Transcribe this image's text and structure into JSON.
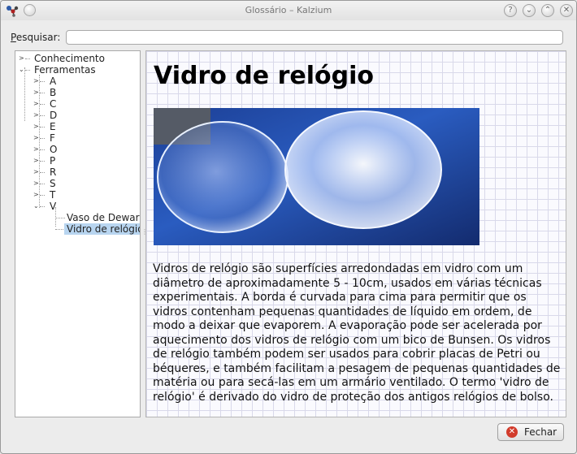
{
  "window": {
    "title": "Glossário – Kalzium",
    "controls": [
      "help",
      "minimize",
      "maximize",
      "close"
    ]
  },
  "search": {
    "label": "Pesquisar:",
    "value": "",
    "placeholder": ""
  },
  "tree": {
    "items": [
      {
        "label": "Conhecimento",
        "expanded": false,
        "level": 0
      },
      {
        "label": "Ferramentas",
        "expanded": true,
        "level": 0
      },
      {
        "label": "A",
        "level": 1
      },
      {
        "label": "B",
        "level": 1
      },
      {
        "label": "C",
        "level": 1
      },
      {
        "label": "D",
        "level": 1
      },
      {
        "label": "E",
        "level": 1
      },
      {
        "label": "F",
        "level": 1
      },
      {
        "label": "O",
        "level": 1
      },
      {
        "label": "P",
        "level": 1
      },
      {
        "label": "R",
        "level": 1
      },
      {
        "label": "S",
        "level": 1
      },
      {
        "label": "T",
        "level": 1
      },
      {
        "label": "V",
        "level": 1,
        "expanded": true
      },
      {
        "label": "Vaso de Dewar",
        "level": 2
      },
      {
        "label": "Vidro de relógio",
        "level": 2,
        "selected": true
      }
    ]
  },
  "article": {
    "title": "Vidro de relógio",
    "body": "Vidros de relógio são superfícies arredondadas em vidro com um diâmetro de aproximadamente 5 - 10cm, usados em várias técnicas experimentais. A borda é curvada para cima para permitir que os vidros contenham pequenas quantidades de líquido em ordem, de modo a deixar que evaporem. A evaporação pode ser acelerada por aquecimento dos vidros de relógio com um bico de Bunsen. Os vidros de relógio também podem ser usados para cobrir placas de Petri ou béqueres, e também facilitam a pesagem de pequenas quantidades de matéria ou para secá-las em um armário ventilado. O termo 'vidro de relógio' é derivado do vidro de proteção dos antigos relógios de bolso."
  },
  "footer": {
    "close_label": "Fechar"
  },
  "colors": {
    "selection": "#b8d5f0",
    "close_icon": "#d23b2b",
    "grid_line": "#d9d9ea"
  }
}
